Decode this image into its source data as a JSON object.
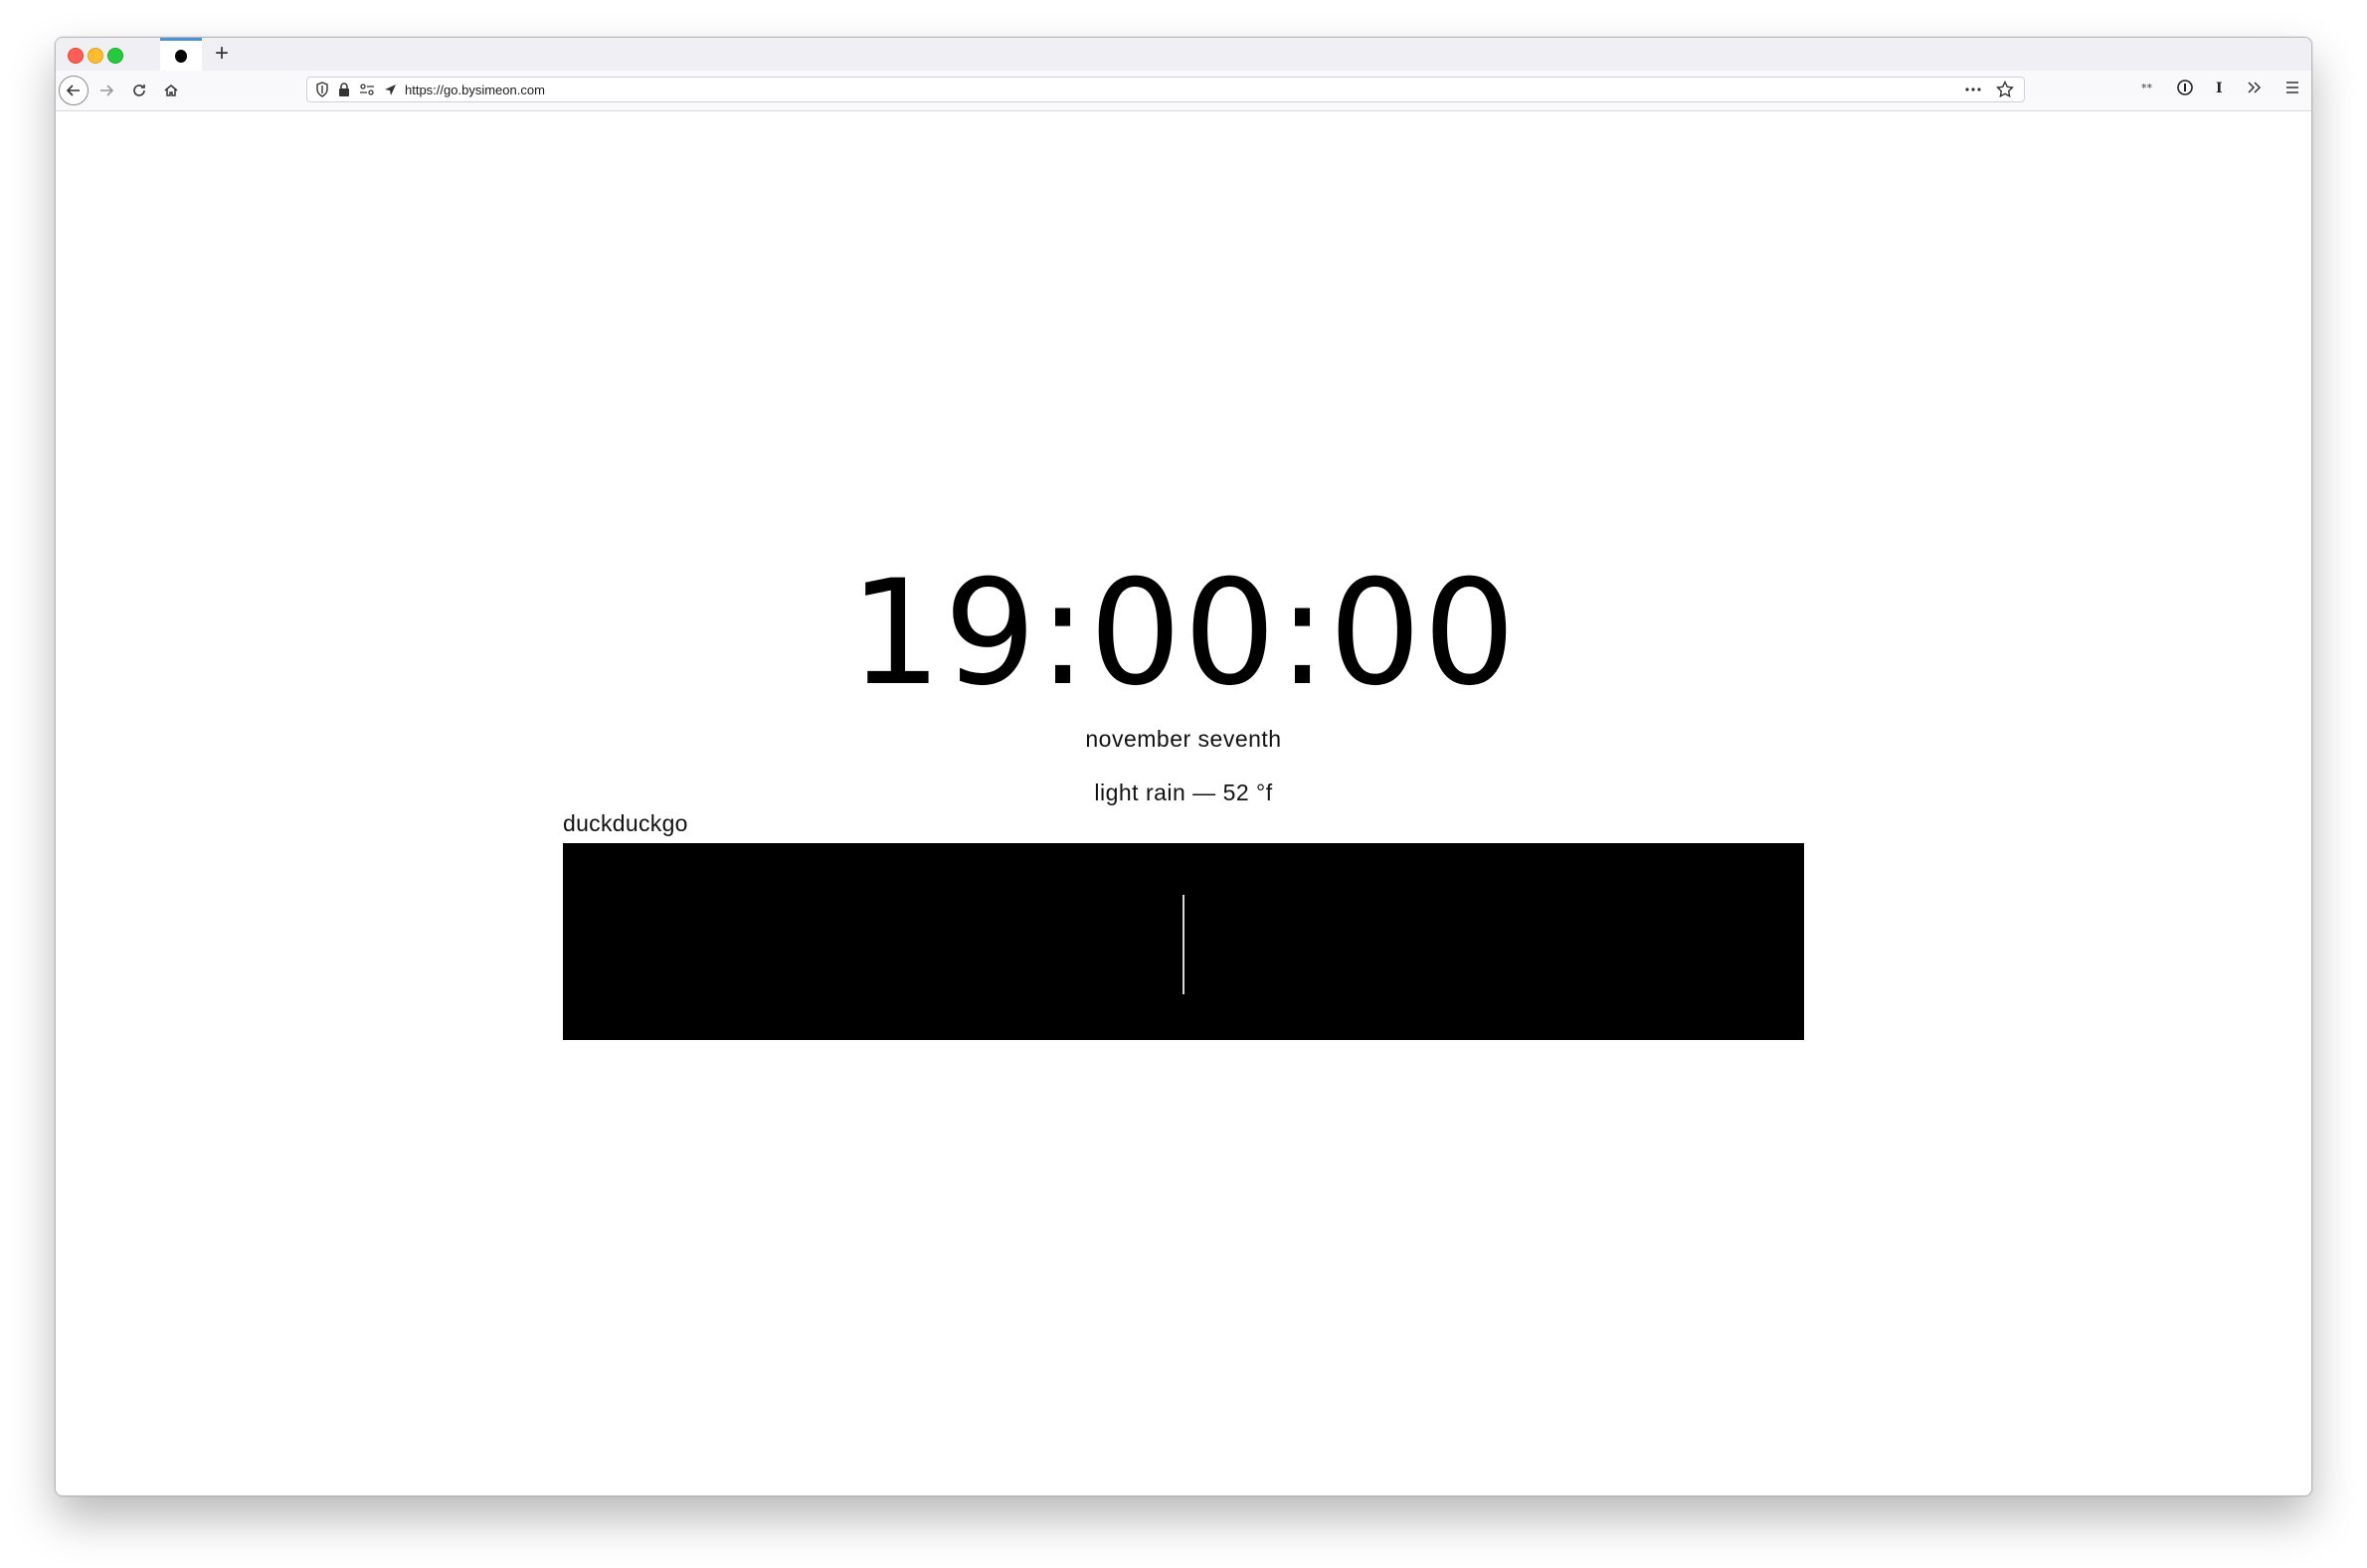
{
  "browser": {
    "new_tab_label": "+",
    "url": "https://go.bysimeon.com"
  },
  "page": {
    "time": "19:00:00",
    "date": "november seventh",
    "weather": "light rain  —  52 °f",
    "search_label": "duckduckgo",
    "search_value": ""
  },
  "colors": {
    "search_bg": "#000000",
    "tab_accent": "#4d8fd6"
  },
  "icons": [
    "back-arrow-icon",
    "forward-arrow-icon",
    "reload-icon",
    "home-icon",
    "shield-icon",
    "lock-icon",
    "permissions-icon",
    "location-arrow-icon",
    "more-icon",
    "star-icon",
    "extension-icon",
    "info-icon",
    "reader-icon",
    "overflow-icon",
    "hamburger-menu-icon"
  ]
}
